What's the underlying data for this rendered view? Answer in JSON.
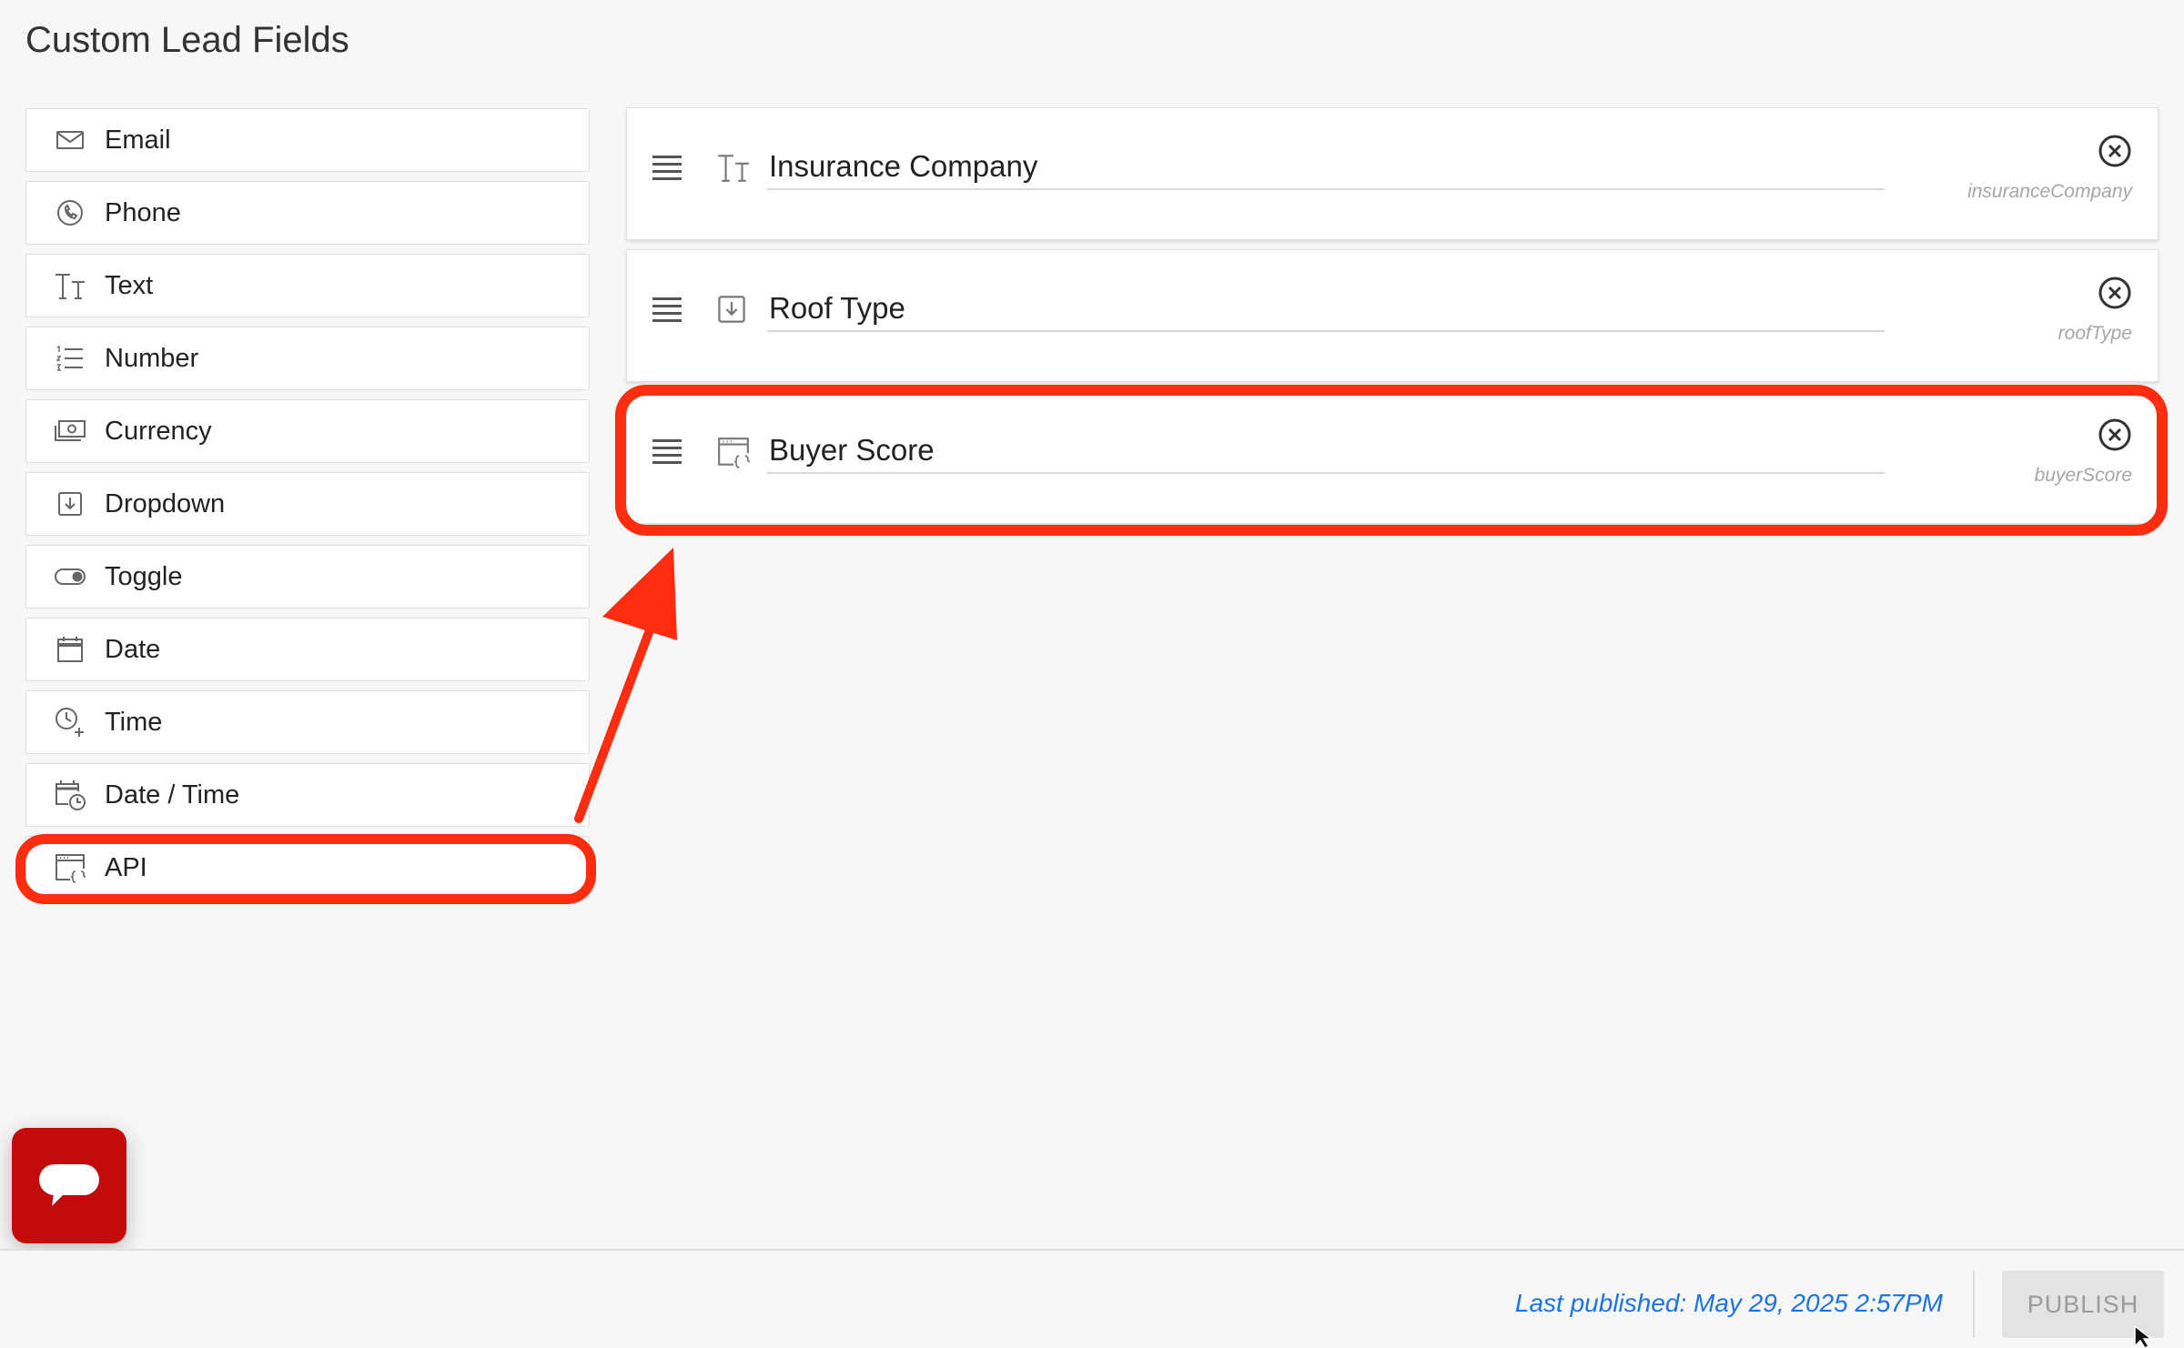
{
  "page": {
    "title": "Custom Lead Fields"
  },
  "palette": {
    "items": [
      {
        "label": "Email",
        "icon": "mail-icon"
      },
      {
        "label": "Phone",
        "icon": "phone-icon"
      },
      {
        "label": "Text",
        "icon": "text-type-icon"
      },
      {
        "label": "Number",
        "icon": "numbered-list-icon"
      },
      {
        "label": "Currency",
        "icon": "money-icon"
      },
      {
        "label": "Dropdown",
        "icon": "dropdown-icon"
      },
      {
        "label": "Toggle",
        "icon": "toggle-icon"
      },
      {
        "label": "Date",
        "icon": "calendar-icon"
      },
      {
        "label": "Time",
        "icon": "clock-plus-icon"
      },
      {
        "label": "Date / Time",
        "icon": "calendar-clock-icon"
      },
      {
        "label": "API",
        "icon": "api-window-icon"
      }
    ]
  },
  "fields": [
    {
      "name": "Insurance Company",
      "key": "insuranceCompany",
      "icon": "text-type-icon"
    },
    {
      "name": "Roof Type",
      "key": "roofType",
      "icon": "dropdown-icon"
    },
    {
      "name": "Buyer Score",
      "key": "buyerScore",
      "icon": "api-window-icon"
    }
  ],
  "footer": {
    "last_published": "Last published: May 29, 2025 2:57PM",
    "publish_label": "PUBLISH"
  },
  "colors": {
    "highlight": "#ff2d10",
    "link": "#1a73e8",
    "chat": "#c20c0c"
  }
}
